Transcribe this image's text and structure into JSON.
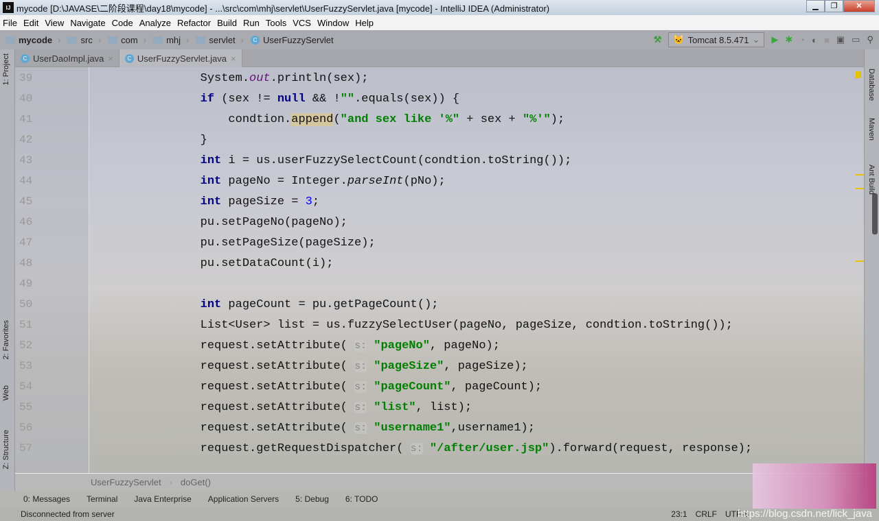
{
  "window": {
    "title": "mycode [D:\\JAVASE\\二阶段课程\\day18\\mycode] - ...\\src\\com\\mhj\\servlet\\UserFuzzyServlet.java [mycode] - IntelliJ IDEA (Administrator)",
    "logo": "IJ",
    "minimize": "▁",
    "restore": "❐",
    "close": "✕"
  },
  "menu": [
    "File",
    "Edit",
    "View",
    "Navigate",
    "Code",
    "Analyze",
    "Refactor",
    "Build",
    "Run",
    "Tools",
    "VCS",
    "Window",
    "Help"
  ],
  "breadcrumb": [
    {
      "label": "mycode",
      "icon": "module-icon"
    },
    {
      "label": "src",
      "icon": "folder-icon"
    },
    {
      "label": "com",
      "icon": "folder-icon"
    },
    {
      "label": "mhj",
      "icon": "folder-icon"
    },
    {
      "label": "servlet",
      "icon": "folder-icon"
    },
    {
      "label": "UserFuzzyServlet",
      "icon": "class-icon"
    }
  ],
  "run": {
    "config": "Tomcat 8.5.471"
  },
  "tabs": [
    {
      "label": "UserDaoImpl.java",
      "active": false
    },
    {
      "label": "UserFuzzyServlet.java",
      "active": true
    }
  ],
  "left_tools": [
    "1: Project",
    "2: Favorites",
    "Web",
    "Z: Structure"
  ],
  "right_tools": [
    "Database",
    "Maven",
    "Ant Build"
  ],
  "code": {
    "lines": [
      {
        "n": "39",
        "t": [
          [
            "p",
            "        System."
          ],
          [
            "fld",
            "out"
          ],
          [
            "p",
            ".println(sex);"
          ]
        ]
      },
      {
        "n": "40",
        "t": [
          [
            "p",
            "        "
          ],
          [
            "kw",
            "if"
          ],
          [
            "p",
            " (sex != "
          ],
          [
            "kw",
            "null"
          ],
          [
            "p",
            " && !"
          ],
          [
            "str",
            "\"\""
          ],
          [
            "p",
            ".equals(sex)) {"
          ]
        ]
      },
      {
        "n": "41",
        "t": [
          [
            "p",
            "            condtion."
          ],
          [
            "hl",
            "append"
          ],
          [
            "p",
            "("
          ],
          [
            "str",
            "\"and sex like '%\""
          ],
          [
            "p",
            " + sex + "
          ],
          [
            "str",
            "\"%'\""
          ],
          [
            "p",
            ");"
          ]
        ]
      },
      {
        "n": "42",
        "t": [
          [
            "p",
            "        }"
          ]
        ]
      },
      {
        "n": "43",
        "t": [
          [
            "p",
            "        "
          ],
          [
            "kw",
            "int"
          ],
          [
            "p",
            " i = us.userFuzzySelectCount(condtion.toString());"
          ]
        ]
      },
      {
        "n": "44",
        "t": [
          [
            "p",
            "        "
          ],
          [
            "kw",
            "int"
          ],
          [
            "p",
            " pageNo = Integer."
          ],
          [
            "it",
            "parseInt"
          ],
          [
            "p",
            "(pNo);"
          ]
        ]
      },
      {
        "n": "45",
        "t": [
          [
            "p",
            "        "
          ],
          [
            "kw",
            "int"
          ],
          [
            "p",
            " pageSize = "
          ],
          [
            "num",
            "3"
          ],
          [
            "p",
            ";"
          ]
        ]
      },
      {
        "n": "46",
        "t": [
          [
            "p",
            "        pu.setPageNo(pageNo);"
          ]
        ]
      },
      {
        "n": "47",
        "t": [
          [
            "p",
            "        pu.setPageSize(pageSize);"
          ]
        ]
      },
      {
        "n": "48",
        "t": [
          [
            "p",
            "        pu.setDataCount(i);"
          ]
        ]
      },
      {
        "n": "49",
        "t": []
      },
      {
        "n": "50",
        "t": [
          [
            "p",
            "        "
          ],
          [
            "kw",
            "int"
          ],
          [
            "p",
            " pageCount = pu.getPageCount();"
          ]
        ]
      },
      {
        "n": "51",
        "t": [
          [
            "p",
            "        List<User> list = us.fuzzySelectUser(pageNo, pageSize, condtion.toString());"
          ]
        ]
      },
      {
        "n": "52",
        "t": [
          [
            "p",
            "        request.setAttribute( "
          ],
          [
            "hint",
            "s:"
          ],
          [
            "p",
            " "
          ],
          [
            "str",
            "\"pageNo\""
          ],
          [
            "p",
            ", pageNo);"
          ]
        ]
      },
      {
        "n": "53",
        "t": [
          [
            "p",
            "        request.setAttribute( "
          ],
          [
            "hint",
            "s:"
          ],
          [
            "p",
            " "
          ],
          [
            "str",
            "\"pageSize\""
          ],
          [
            "p",
            ", pageSize);"
          ]
        ]
      },
      {
        "n": "54",
        "t": [
          [
            "p",
            "        request.setAttribute( "
          ],
          [
            "hint",
            "s:"
          ],
          [
            "p",
            " "
          ],
          [
            "str",
            "\"pageCount\""
          ],
          [
            "p",
            ", pageCount);"
          ]
        ]
      },
      {
        "n": "55",
        "t": [
          [
            "p",
            "        request.setAttribute( "
          ],
          [
            "hint",
            "s:"
          ],
          [
            "p",
            " "
          ],
          [
            "str",
            "\"list\""
          ],
          [
            "p",
            ", list);"
          ]
        ]
      },
      {
        "n": "56",
        "t": [
          [
            "p",
            "        request.setAttribute( "
          ],
          [
            "hint",
            "s:"
          ],
          [
            "p",
            " "
          ],
          [
            "str",
            "\"username1\""
          ],
          [
            "p",
            ",username1);"
          ]
        ]
      },
      {
        "n": "57",
        "t": [
          [
            "p",
            "        request.getRequestDispatcher( "
          ],
          [
            "hint",
            "s:"
          ],
          [
            "p",
            " "
          ],
          [
            "str",
            "\"/after/user.jsp\""
          ],
          [
            "p",
            ").forward(request, response);"
          ]
        ]
      }
    ]
  },
  "editor_breadcrumb": [
    "UserFuzzyServlet",
    "doGet()"
  ],
  "tool_windows": [
    "0: Messages",
    "Terminal",
    "Java Enterprise",
    "Application Servers",
    "5: Debug",
    "6: TODO"
  ],
  "status": {
    "message": "Disconnected from server",
    "position": "23:1",
    "line_sep": "CRLF",
    "encoding": "UTF-8"
  },
  "watermark": "https://blog.csdn.net/lick_java"
}
